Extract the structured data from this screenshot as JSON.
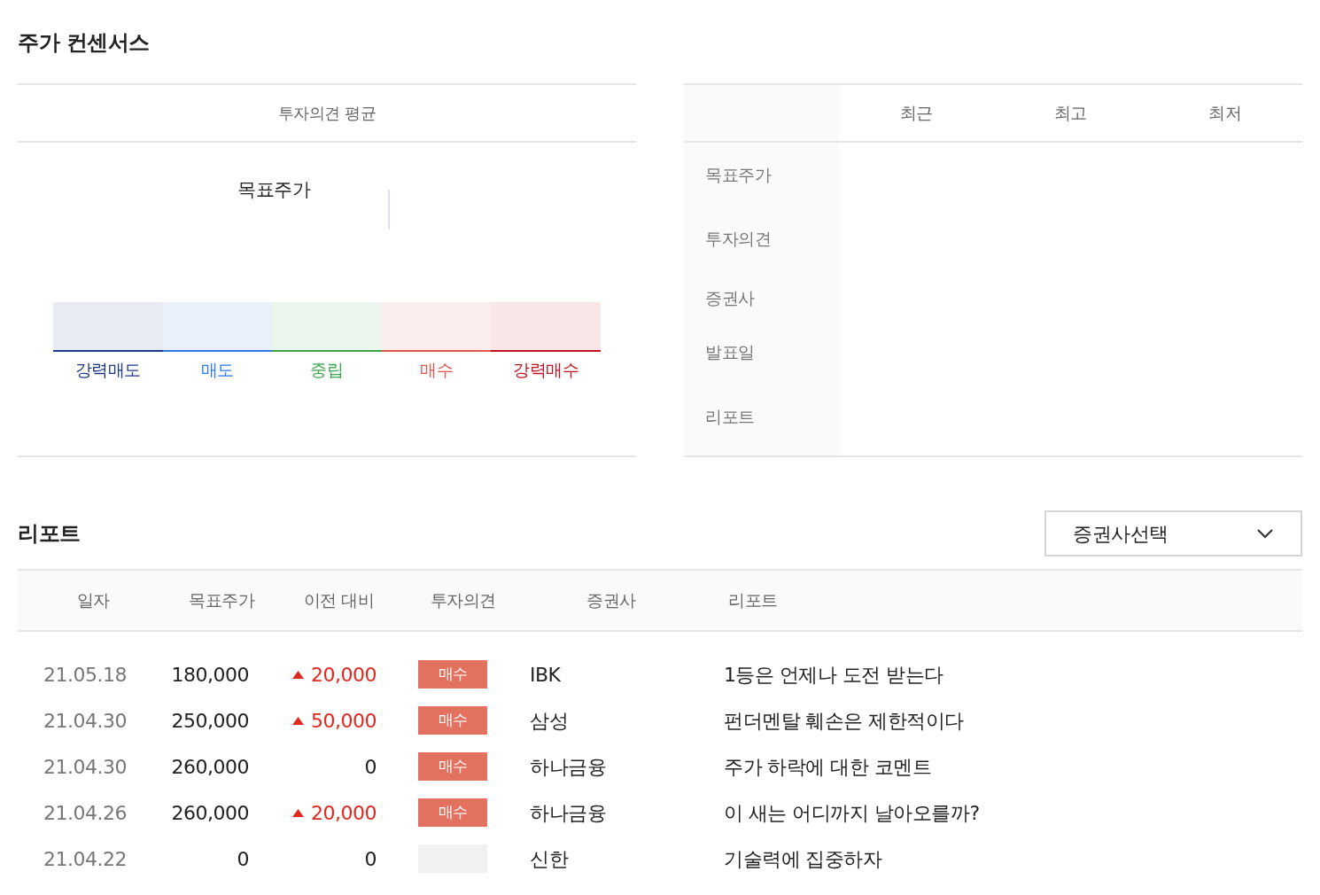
{
  "consensus": {
    "title": "주가 컨센서스",
    "average": {
      "header": "투자의견 평균",
      "target_label": "목표주가",
      "scale": [
        {
          "label": "강력매도",
          "color": "#1d3a8a"
        },
        {
          "label": "매도",
          "color": "#2f7ae5"
        },
        {
          "label": "중립",
          "color": "#3fa34d"
        },
        {
          "label": "매수",
          "color": "#e2574c"
        },
        {
          "label": "강력매수",
          "color": "#c1121f"
        }
      ]
    },
    "summary": {
      "columns": [
        "최근",
        "최고",
        "최저"
      ],
      "row_labels": [
        "목표주가",
        "투자의견",
        "증권사",
        "발표일",
        "리포트"
      ]
    }
  },
  "reports": {
    "title": "리포트",
    "broker_select": {
      "value": "증권사선택"
    },
    "columns": [
      "일자",
      "목표주가",
      "이전 대비",
      "투자의견",
      "증권사",
      "리포트"
    ],
    "rows": [
      {
        "date": "21.05.18",
        "target": "180,000",
        "change": {
          "kind": "up",
          "value": "20,000"
        },
        "opinion": {
          "kind": "badge",
          "label": "매수"
        },
        "broker": "IBK",
        "title": "1등은 언제나 도전 받는다"
      },
      {
        "date": "21.04.30",
        "target": "250,000",
        "change": {
          "kind": "up",
          "value": "50,000"
        },
        "opinion": {
          "kind": "badge",
          "label": "매수"
        },
        "broker": "삼성",
        "title": "펀더멘탈 훼손은 제한적이다"
      },
      {
        "date": "21.04.30",
        "target": "260,000",
        "change": {
          "kind": "flat",
          "value": "0"
        },
        "opinion": {
          "kind": "badge",
          "label": "매수"
        },
        "broker": "하나금융",
        "title": "주가 하락에 대한 코멘트"
      },
      {
        "date": "21.04.26",
        "target": "260,000",
        "change": {
          "kind": "up",
          "value": "20,000"
        },
        "opinion": {
          "kind": "badge",
          "label": "매수"
        },
        "broker": "하나금융",
        "title": "이 새는 어디까지 날아오를까?"
      },
      {
        "date": "21.04.22",
        "target": "0",
        "change": {
          "kind": "flat",
          "value": "0"
        },
        "opinion": {
          "kind": "blank"
        },
        "broker": "신한",
        "title": "기술력에 집중하자"
      }
    ]
  }
}
